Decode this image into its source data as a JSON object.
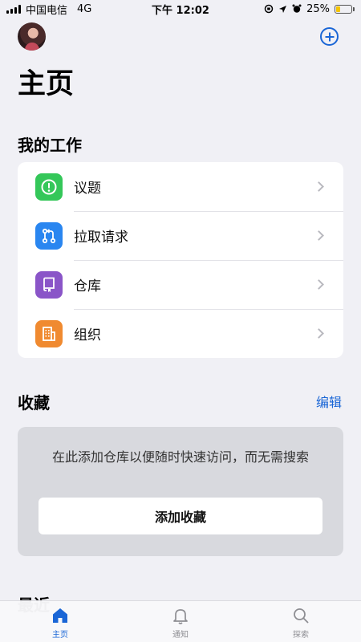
{
  "status_bar": {
    "carrier": "中国电信",
    "network": "4G",
    "time": "下午 12:02",
    "battery": "25%",
    "battery_level": 0.25
  },
  "header": {
    "avatar": "avatar",
    "add_icon": "plus-circle-icon",
    "title": "主页"
  },
  "my_work": {
    "title": "我的工作",
    "items": [
      {
        "label": "议题",
        "icon": "issue-icon",
        "color": "#34c759"
      },
      {
        "label": "拉取请求",
        "icon": "pull-request-icon",
        "color": "#2a86f0"
      },
      {
        "label": "仓库",
        "icon": "repo-icon",
        "color": "#8a55c8"
      },
      {
        "label": "组织",
        "icon": "organization-icon",
        "color": "#f08a30"
      }
    ]
  },
  "favorites": {
    "title": "收藏",
    "edit_label": "编辑",
    "empty_text": "在此添加仓库以便随时快速访问，而无需搜索",
    "add_button": "添加收藏"
  },
  "recent": {
    "title": "最近"
  },
  "tab_bar": {
    "tabs": [
      {
        "label": "主页",
        "icon": "home-icon",
        "active": true
      },
      {
        "label": "通知",
        "icon": "bell-icon",
        "active": false
      },
      {
        "label": "探索",
        "icon": "search-icon",
        "active": false
      }
    ]
  },
  "colors": {
    "accent": "#1a66d6",
    "background": "#f0f0f5"
  }
}
